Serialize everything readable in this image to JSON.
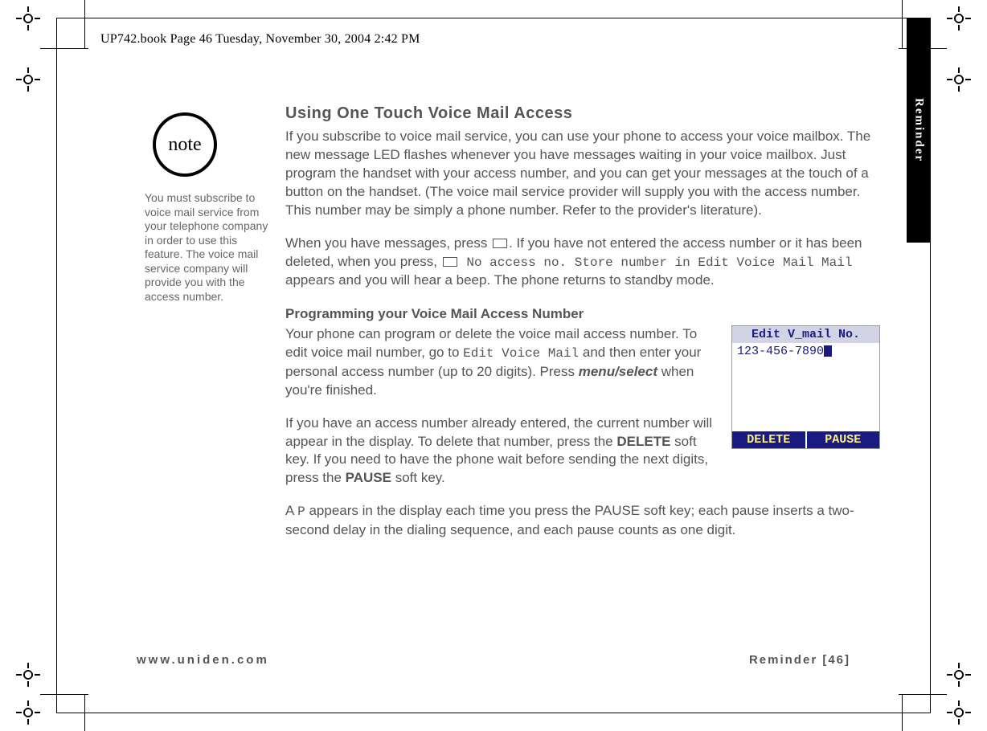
{
  "header": {
    "running_head": "UP742.book  Page 46  Tuesday, November 30, 2004  2:42 PM"
  },
  "side_tab": "Reminder",
  "note": {
    "badge": "note",
    "text": "You must subscribe to voice mail service from your telephone company in order to use this feature. The voice mail service company will provide you with the access number."
  },
  "main": {
    "h1": "Using One Touch Voice Mail Access",
    "p1": "If you subscribe to voice mail service, you can use your phone to access your voice mailbox. The new message LED flashes whenever you have messages waiting in your voice mailbox. Just program the handset with your access number, and you can get your messages at the touch of a button on the handset. (The voice mail service provider will supply you with the access number. This number may be simply a phone number. Refer to the provider's literature).",
    "p2a": "When you have messages, press ",
    "p2b": ". If you have not entered the access number or it has been deleted, when you press, ",
    "p2_code": " No access no. Store number in Edit Voice Mail Mail",
    "p2c": " appears and you will hear a beep. The phone returns to standby mode.",
    "h2": "Programming your Voice Mail Access Number",
    "p3a": "Your phone can program or delete the voice mail access number. To edit voice mail number, go to ",
    "p3_code": "Edit Voice Mail",
    "p3b": " and then enter your personal access number (up to 20 digits). Press ",
    "p3_bold": "menu/select",
    "p3c": " when you're finished.",
    "p4a": "If you have an access number already entered, the current number will appear in the display. To delete that number, press the ",
    "p4_del": "DELETE",
    "p4b": " soft key. If you need to have the phone wait before sending the next digits, press the ",
    "p4_pause": "PAUSE",
    "p4c": " soft key.",
    "p5a": "A ",
    "p5_code": "P",
    "p5b": " appears in the display each time you press the PAUSE soft key; each pause inserts a two-second delay in the dialing sequence, and each pause counts as one digit."
  },
  "lcd": {
    "title": "Edit V_mail No.",
    "number": "123-456-7890",
    "softkey_left": "DELETE",
    "softkey_right": "PAUSE"
  },
  "footer": {
    "left": "www.uniden.com",
    "right": "Reminder [46]"
  }
}
